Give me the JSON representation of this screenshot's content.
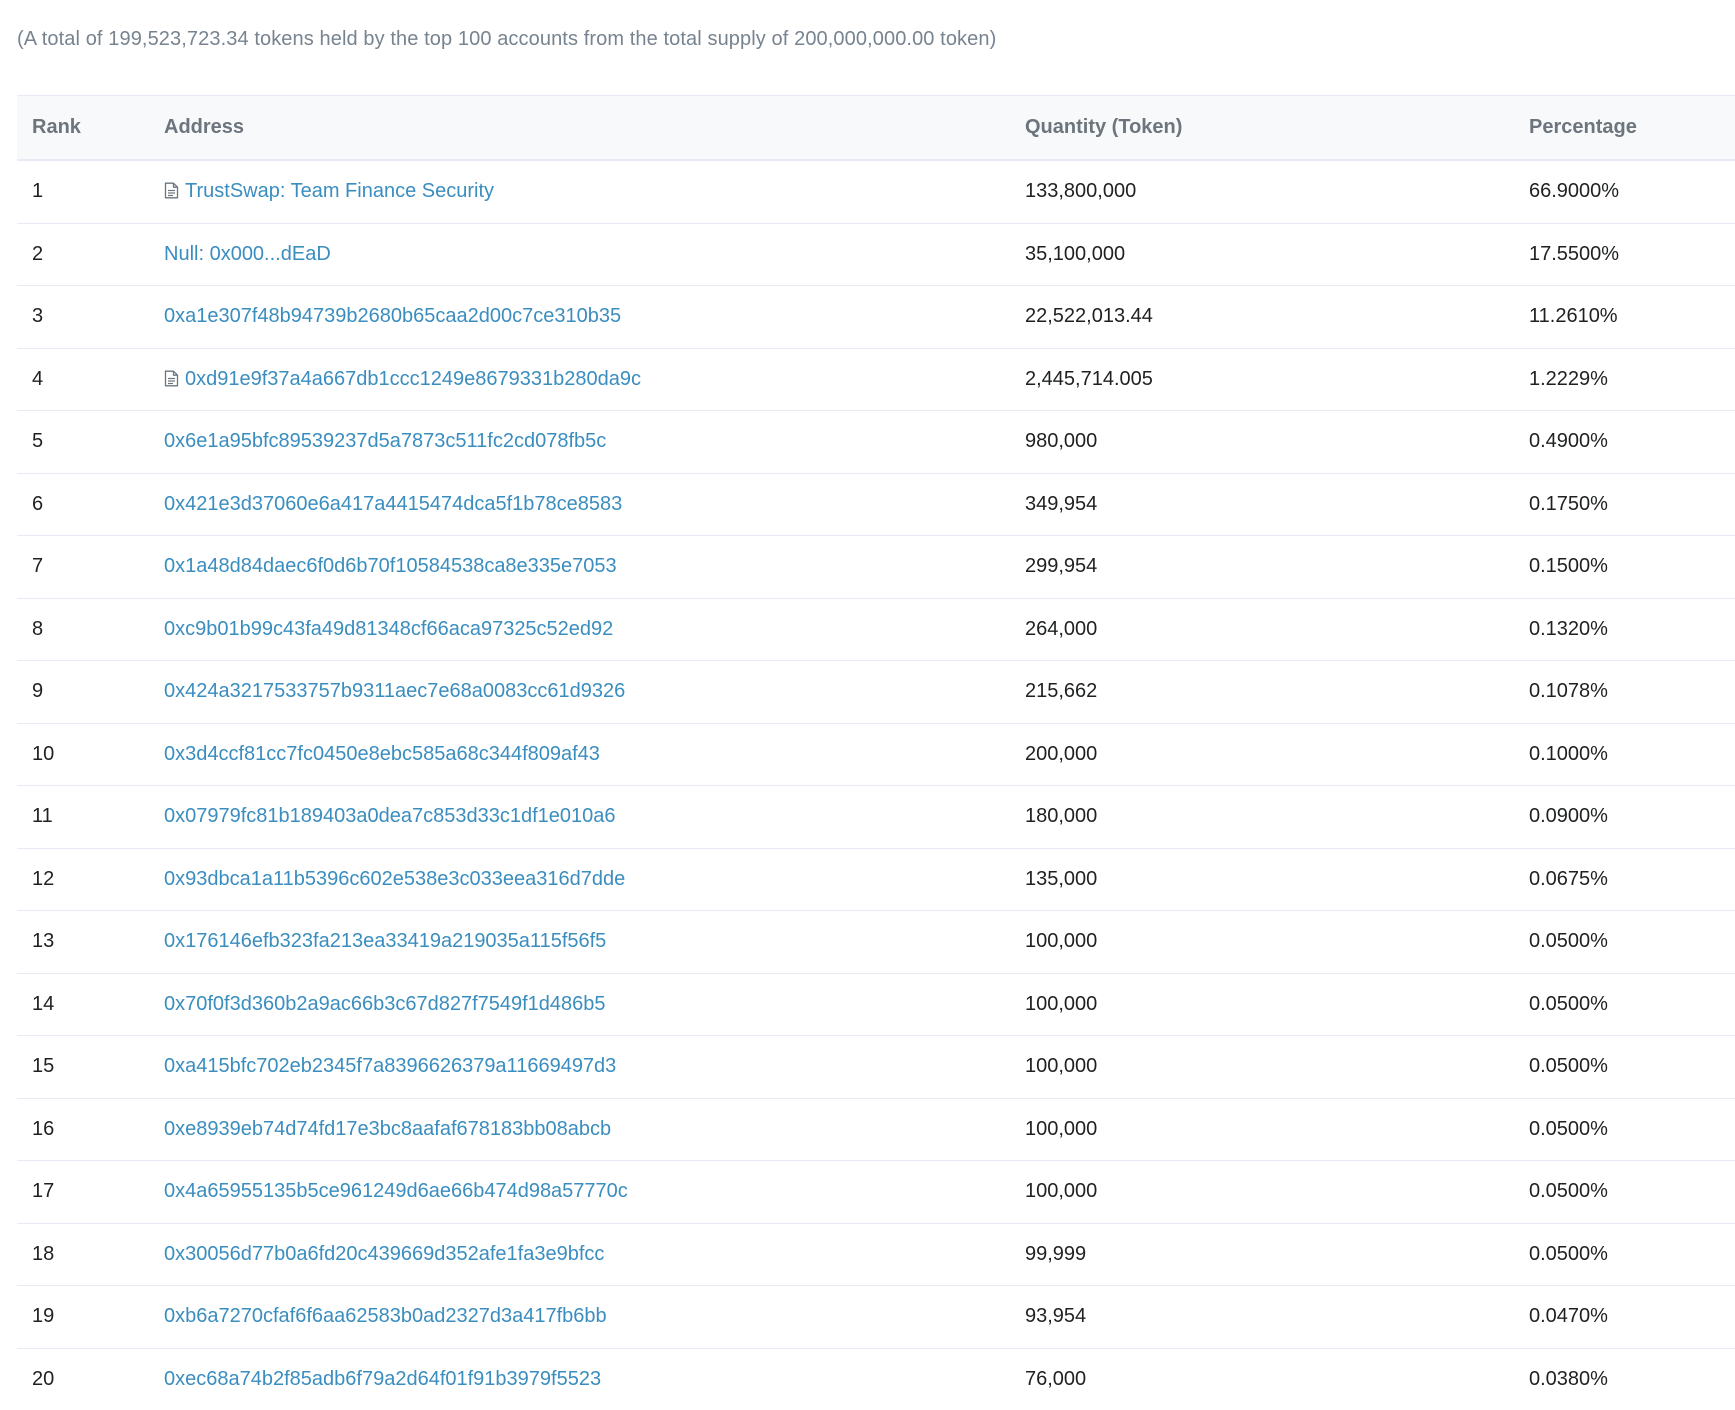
{
  "summary_text": "(A total of 199,523,723.34 tokens held by the top 100 accounts from the total supply of 200,000,000.00 token)",
  "table": {
    "headers": {
      "rank": "Rank",
      "address": "Address",
      "quantity": "Quantity (Token)",
      "percentage": "Percentage"
    },
    "rows": [
      {
        "rank": "1",
        "address": "TrustSwap: Team Finance Security",
        "is_contract": true,
        "quantity": "133,800,000",
        "percentage": "66.9000%"
      },
      {
        "rank": "2",
        "address": "Null: 0x000...dEaD",
        "is_contract": false,
        "quantity": "35,100,000",
        "percentage": "17.5500%"
      },
      {
        "rank": "3",
        "address": "0xa1e307f48b94739b2680b65caa2d00c7ce310b35",
        "is_contract": false,
        "quantity": "22,522,013.44",
        "percentage": "11.2610%"
      },
      {
        "rank": "4",
        "address": "0xd91e9f37a4a667db1ccc1249e8679331b280da9c",
        "is_contract": true,
        "quantity": "2,445,714.005",
        "percentage": "1.2229%"
      },
      {
        "rank": "5",
        "address": "0x6e1a95bfc89539237d5a7873c511fc2cd078fb5c",
        "is_contract": false,
        "quantity": "980,000",
        "percentage": "0.4900%"
      },
      {
        "rank": "6",
        "address": "0x421e3d37060e6a417a4415474dca5f1b78ce8583",
        "is_contract": false,
        "quantity": "349,954",
        "percentage": "0.1750%"
      },
      {
        "rank": "7",
        "address": "0x1a48d84daec6f0d6b70f10584538ca8e335e7053",
        "is_contract": false,
        "quantity": "299,954",
        "percentage": "0.1500%"
      },
      {
        "rank": "8",
        "address": "0xc9b01b99c43fa49d81348cf66aca97325c52ed92",
        "is_contract": false,
        "quantity": "264,000",
        "percentage": "0.1320%"
      },
      {
        "rank": "9",
        "address": "0x424a3217533757b9311aec7e68a0083cc61d9326",
        "is_contract": false,
        "quantity": "215,662",
        "percentage": "0.1078%"
      },
      {
        "rank": "10",
        "address": "0x3d4ccf81cc7fc0450e8ebc585a68c344f809af43",
        "is_contract": false,
        "quantity": "200,000",
        "percentage": "0.1000%"
      },
      {
        "rank": "11",
        "address": "0x07979fc81b189403a0dea7c853d33c1df1e010a6",
        "is_contract": false,
        "quantity": "180,000",
        "percentage": "0.0900%"
      },
      {
        "rank": "12",
        "address": "0x93dbca1a11b5396c602e538e3c033eea316d7dde",
        "is_contract": false,
        "quantity": "135,000",
        "percentage": "0.0675%"
      },
      {
        "rank": "13",
        "address": "0x176146efb323fa213ea33419a219035a115f56f5",
        "is_contract": false,
        "quantity": "100,000",
        "percentage": "0.0500%"
      },
      {
        "rank": "14",
        "address": "0x70f0f3d360b2a9ac66b3c67d827f7549f1d486b5",
        "is_contract": false,
        "quantity": "100,000",
        "percentage": "0.0500%"
      },
      {
        "rank": "15",
        "address": "0xa415bfc702eb2345f7a8396626379a11669497d3",
        "is_contract": false,
        "quantity": "100,000",
        "percentage": "0.0500%"
      },
      {
        "rank": "16",
        "address": "0xe8939eb74d74fd17e3bc8aafaf678183bb08abcb",
        "is_contract": false,
        "quantity": "100,000",
        "percentage": "0.0500%"
      },
      {
        "rank": "17",
        "address": "0x4a65955135b5ce961249d6ae66b474d98a57770c",
        "is_contract": false,
        "quantity": "100,000",
        "percentage": "0.0500%"
      },
      {
        "rank": "18",
        "address": "0x30056d77b0a6fd20c439669d352afe1fa3e9bfcc",
        "is_contract": false,
        "quantity": "99,999",
        "percentage": "0.0500%"
      },
      {
        "rank": "19",
        "address": "0xb6a7270cfaf6f6aa62583b0ad2327d3a417fb6bb",
        "is_contract": false,
        "quantity": "93,954",
        "percentage": "0.0470%"
      },
      {
        "rank": "20",
        "address": "0xec68a74b2f85adb6f79a2d64f01f91b3979f5523",
        "is_contract": false,
        "quantity": "76,000",
        "percentage": "0.0380%"
      }
    ]
  },
  "colors": {
    "link": "#3a8dbf",
    "header_bg": "#f8f9fa",
    "muted_text": "#77838f",
    "border": "#e7eaf3"
  },
  "icons": {
    "contract": "contract-file-icon"
  }
}
